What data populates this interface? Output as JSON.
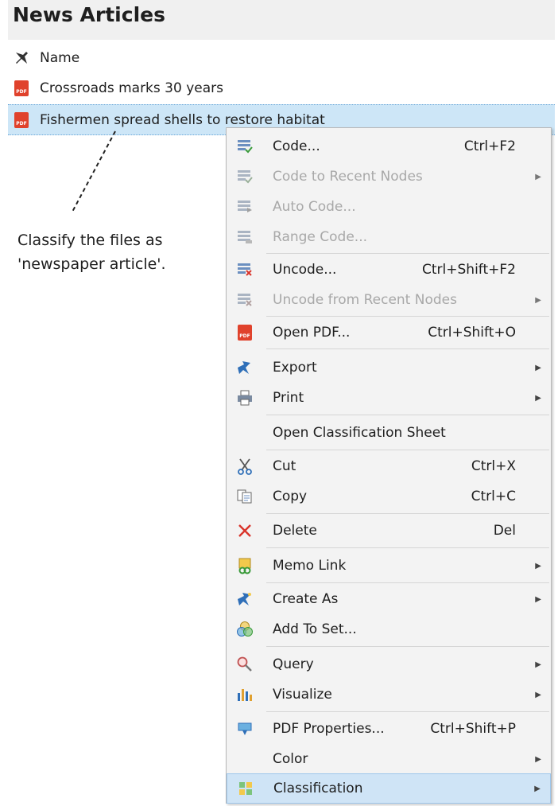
{
  "panel": {
    "title": "News Articles",
    "header_label": "Name",
    "rows": [
      {
        "name": "Crossroads marks 30 years"
      },
      {
        "name": "Fishermen spread shells to restore habitat"
      }
    ]
  },
  "annotation": {
    "line1": "Classify the files as",
    "line2": "'newspaper article'."
  },
  "menu": {
    "items": [
      {
        "label": "Code...",
        "shortcut": "Ctrl+F2",
        "icon": "code-icon"
      },
      {
        "label": "Code to Recent Nodes",
        "icon": "code-recent-icon",
        "submenu": true,
        "disabled": true
      },
      {
        "label": "Auto Code...",
        "icon": "auto-code-icon",
        "disabled": true
      },
      {
        "label": "Range Code...",
        "icon": "range-code-icon",
        "disabled": true
      },
      {
        "label": "Uncode...",
        "shortcut": "Ctrl+Shift+F2",
        "icon": "uncode-icon"
      },
      {
        "label": "Uncode from Recent Nodes",
        "icon": "uncode-recent-icon",
        "submenu": true,
        "disabled": true
      },
      {
        "label": "Open PDF...",
        "shortcut": "Ctrl+Shift+O",
        "icon": "pdf-icon"
      },
      {
        "label": "Export",
        "icon": "export-icon",
        "submenu": true
      },
      {
        "label": "Print",
        "icon": "print-icon",
        "submenu": true
      },
      {
        "label": "Open Classification Sheet"
      },
      {
        "label": "Cut",
        "shortcut": "Ctrl+X",
        "icon": "scissors-icon"
      },
      {
        "label": "Copy",
        "shortcut": "Ctrl+C",
        "icon": "copy-icon"
      },
      {
        "label": "Delete",
        "shortcut": "Del",
        "icon": "delete-icon"
      },
      {
        "label": "Memo Link",
        "icon": "memo-link-icon",
        "submenu": true
      },
      {
        "label": "Create As",
        "icon": "create-as-icon",
        "submenu": true
      },
      {
        "label": "Add To Set...",
        "icon": "add-to-set-icon"
      },
      {
        "label": "Query",
        "icon": "query-icon",
        "submenu": true
      },
      {
        "label": "Visualize",
        "icon": "chart-icon",
        "submenu": true
      },
      {
        "label": "PDF Properties...",
        "shortcut": "Ctrl+Shift+P",
        "icon": "properties-icon"
      },
      {
        "label": "Color",
        "submenu": true
      },
      {
        "label": "Classification",
        "icon": "classification-icon",
        "submenu": true,
        "highlighted": true
      }
    ],
    "submenu_arrow": "▶"
  },
  "colors": {
    "selection": "#cde6f7",
    "menu_background": "#f3f3f3",
    "pdf_red": "#e0422c",
    "delete_red": "#d9342b",
    "highlight": "#cfe4f6"
  }
}
